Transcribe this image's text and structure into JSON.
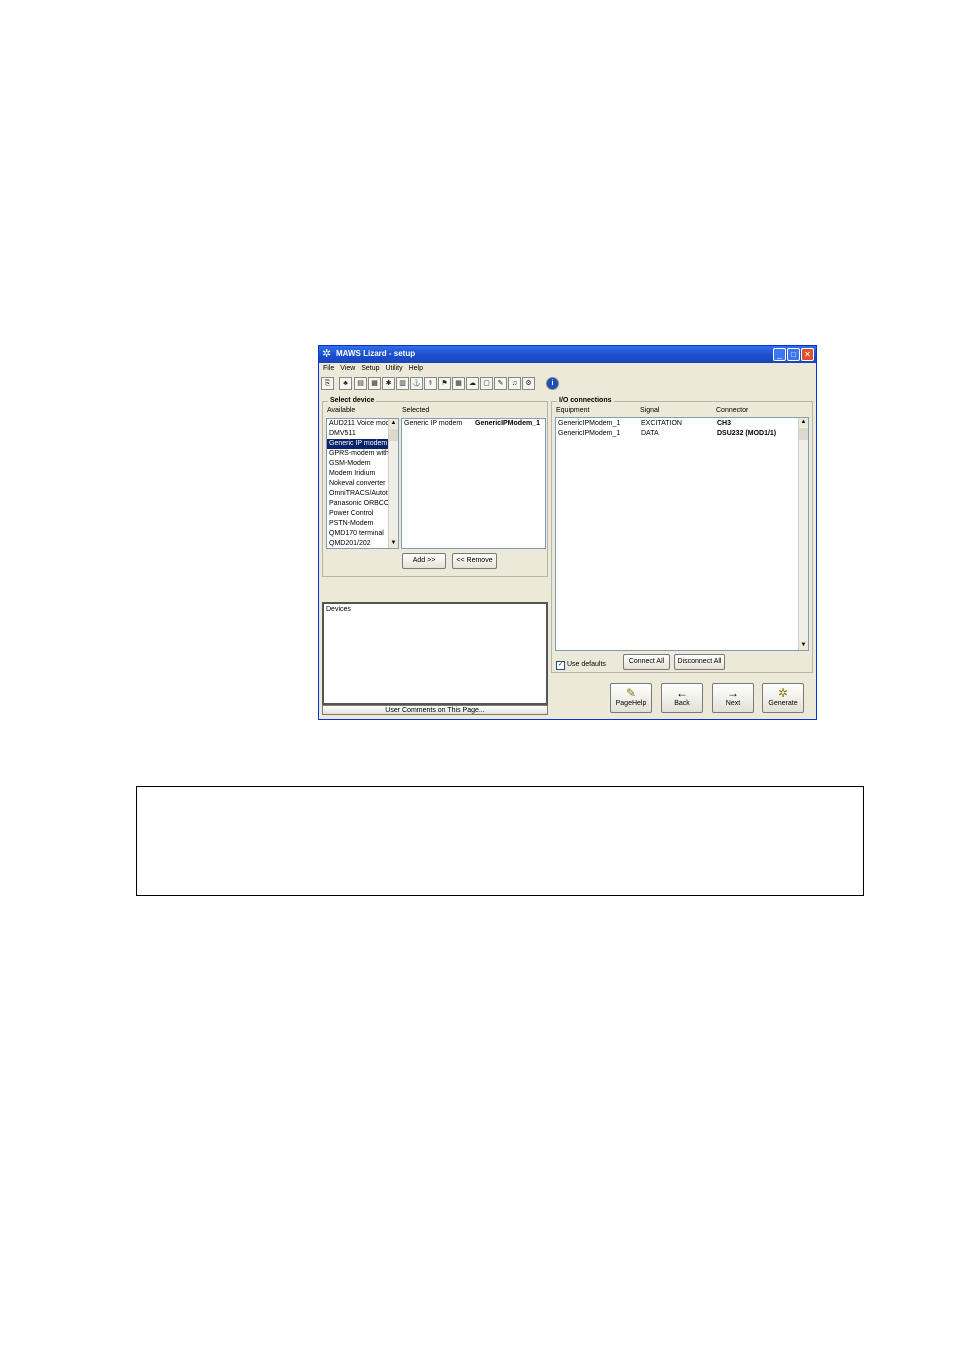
{
  "window": {
    "title": "MAWS Lizard - setup"
  },
  "title_buttons": {
    "minimize": "_",
    "maximize": "□",
    "close": "✕"
  },
  "menu": [
    "File",
    "View",
    "Setup",
    "Utility",
    "Help"
  ],
  "toolbar_icons": [
    "save-icon",
    "network-icon",
    "dev-icon",
    "dev2-icon",
    "sensor-icon",
    "logger-icon",
    "wind-icon",
    "antenna-icon",
    "flag-icon",
    "grid-icon",
    "cloud-icon",
    "doc-icon",
    "pen-icon",
    "alarm-icon",
    "gear-icon",
    "info-icon"
  ],
  "toolbar_glyphs": [
    "⎘",
    "♣",
    "▤",
    "▦",
    "✱",
    "▥",
    "⚓",
    "⚕",
    "⚑",
    "▦",
    "☁",
    "▢",
    "✎",
    "♫",
    "⚙",
    "i"
  ],
  "select_device": {
    "label": "Select device",
    "available_label": "Available",
    "selected_label": "Selected",
    "available": [
      "AUD211 Voice mode",
      "DMV511",
      "Generic IP modem",
      "GPRS-modem with i",
      "GSM-Modem",
      "Modem Iridium",
      "Nokeval converter",
      "OmniTRACS/Autotrc",
      "Panasonic ORBCOM",
      "Power Control",
      "PSTN-Modem",
      "QMD170 terminal",
      "QMD201/202"
    ],
    "available_selected_index": 2,
    "selected": [
      {
        "type": "Generic IP modem",
        "name": "GenericIPModem_1"
      }
    ],
    "add_button": "Add >>",
    "remove_button": "<< Remove"
  },
  "devices": {
    "text": "Devices",
    "comments_button": "User Comments on This Page..."
  },
  "io": {
    "label": "I/O connections",
    "col_equipment": "Equipment",
    "col_signal": "Signal",
    "col_connector": "Connector",
    "rows": [
      {
        "equipment": "GenericIPModem_1",
        "signal": "EXCITATION",
        "connector": "CH3"
      },
      {
        "equipment": "GenericIPModem_1",
        "signal": "DATA",
        "connector": "DSU232 (MOD1/1)"
      }
    ],
    "use_defaults": "Use defaults",
    "use_defaults_checked": true,
    "connect_all": "Connect All",
    "disconnect_all": "Disconnect All"
  },
  "nav": {
    "pagehelp": "PageHelp",
    "back": "Back",
    "next": "Next",
    "generate": "Generate",
    "pagehelp_glyph": "✎",
    "back_glyph": "←",
    "next_glyph": "→",
    "generate_glyph": "✲"
  }
}
